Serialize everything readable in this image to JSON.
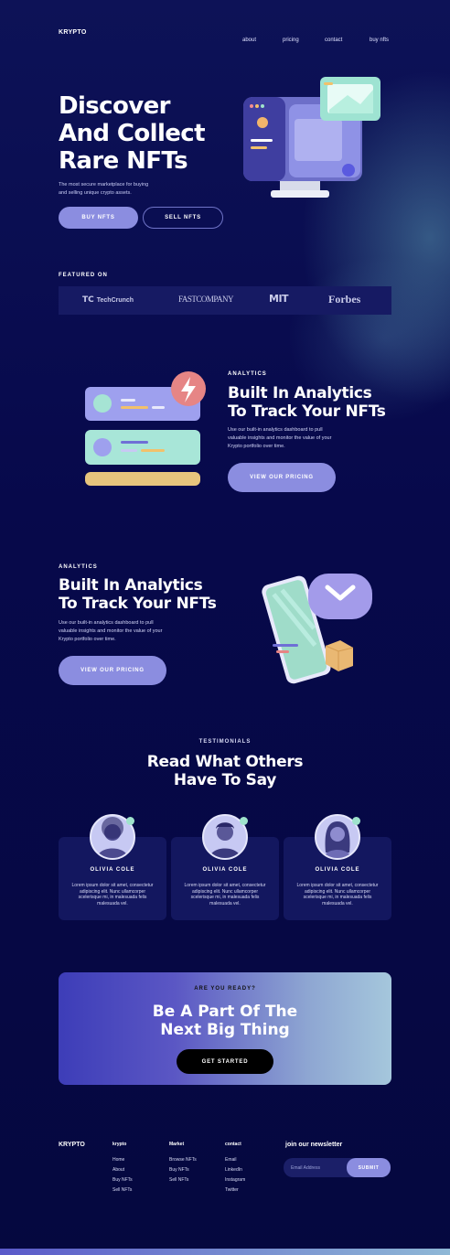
{
  "nav": {
    "logo": "KRYPTO",
    "links": [
      "about",
      "pricing",
      "contact",
      "buy nfts"
    ]
  },
  "hero": {
    "title_lines": [
      "Discover",
      "And Collect",
      "Rare NFTs"
    ],
    "subtitle_lines": [
      "The most secure marketplace for buying",
      "and selling unique crypto assets."
    ],
    "buy_label": "BUY NFTS",
    "sell_label": "SELL NFTS"
  },
  "featured": {
    "label": "FEATURED ON",
    "brands": [
      "TechCrunch",
      "FASTCOMPANY",
      "MIT",
      "Forbes"
    ]
  },
  "feature1": {
    "label": "ANALYTICS",
    "title_lines": [
      "Built In Analytics",
      "To Track Your NFTs"
    ],
    "text_lines": [
      "Use our built-in analytics dashboard to pull",
      "valuable insights and monitor the value of your",
      "Krypto portfolio over time."
    ],
    "button": "VIEW OUR PRICING"
  },
  "feature2": {
    "label": "ANALYTICS",
    "title_lines": [
      "Built In Analytics",
      "To Track Your NFTs"
    ],
    "text_lines": [
      "Use our built-in analytics dashboard to pull",
      "valuable insights and monitor the value of your",
      "Krypto portfolio over time."
    ],
    "button": "VIEW OUR PRICING"
  },
  "testimonials": {
    "label": "TESTIMONIALS",
    "title_lines": [
      "Read What Others",
      "Have To Say"
    ],
    "cards": [
      {
        "name": "OLIVIA COLE",
        "text_lines": [
          "Lorem ipsum dolor sit amet, consectetur",
          "adipiscing elit. Nunc ullamcorper",
          "scelerisque mi, in malesuada felis",
          "malesuada vel."
        ]
      },
      {
        "name": "OLIVIA COLE",
        "text_lines": [
          "Lorem ipsum dolor sit amet, consectetur",
          "adipiscing elit. Nunc ullamcorper",
          "scelerisque mi, in malesuada felis",
          "malesuada vel."
        ]
      },
      {
        "name": "OLIVIA COLE",
        "text_lines": [
          "Lorem ipsum dolor sit amet, consectetur",
          "adipiscing elit. Nunc ullamcorper",
          "scelerisque mi, in malesuada felis",
          "malesuada vel."
        ]
      }
    ]
  },
  "cta": {
    "label": "ARE YOU READY?",
    "title_lines": [
      "Be A Part Of The",
      "Next Big Thing"
    ],
    "button": "GET STARTED"
  },
  "footer": {
    "logo": "KRYPTO",
    "columns": [
      {
        "heading": "krypto",
        "links": [
          "Home",
          "About",
          "Buy NFTs",
          "Sell NFTs"
        ]
      },
      {
        "heading": "Market",
        "links": [
          "Browse NFTs",
          "Buy NFTs",
          "Sell NFTs"
        ]
      },
      {
        "heading": "contact",
        "links": [
          "Email",
          "LinkedIn",
          "Instagram",
          "Twitter"
        ]
      }
    ],
    "newsletter_title": "join our newsletter",
    "email_placeholder": "Email Address",
    "submit": "SUBMIT"
  },
  "colors": {
    "background": "#06094a",
    "accent": "#8b8de0",
    "mint": "#9fe3cc"
  }
}
